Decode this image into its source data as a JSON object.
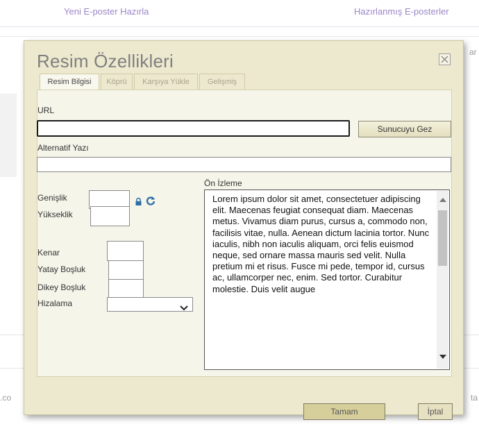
{
  "background": {
    "links": [
      "Yeni E-poster Hazırla",
      "Hazırlanmış E-posterler"
    ],
    "side_texts": [
      ".co",
      "ta",
      "ar"
    ]
  },
  "dialog": {
    "title": "Resim Özellikleri",
    "close_icon": "close-icon",
    "tabs": [
      {
        "label": "Resim Bilgisi",
        "active": true
      },
      {
        "label": "Köprü",
        "active": false
      },
      {
        "label": "Karşıya Yükle",
        "active": false
      },
      {
        "label": "Gelişmiş",
        "active": false
      }
    ],
    "url": {
      "label": "URL",
      "value": ""
    },
    "browse_button": "Sunucuyu Gez",
    "alt_text": {
      "label": "Alternatif Yazı",
      "value": ""
    },
    "width": {
      "label": "Genişlik",
      "value": ""
    },
    "height": {
      "label": "Yükseklik",
      "value": ""
    },
    "lock_icon": "lock-icon",
    "reset_icon": "reset-size-icon",
    "border": {
      "label": "Kenar",
      "value": ""
    },
    "hspace": {
      "label": "Yatay Boşluk",
      "value": ""
    },
    "vspace": {
      "label": "Dikey Boşluk",
      "value": ""
    },
    "align": {
      "label": "Hizalama",
      "selected": ""
    },
    "preview": {
      "label": "Ön İzleme",
      "text": "Lorem ipsum dolor sit amet, consectetuer adipiscing elit. Maecenas feugiat consequat diam. Maecenas metus. Vivamus diam purus, cursus a, commodo non, facilisis vitae, nulla. Aenean dictum lacinia tortor. Nunc iaculis, nibh non iaculis aliquam, orci felis euismod neque, sed ornare massa mauris sed velit. Nulla pretium mi et risus. Fusce mi pede, tempor id, cursus ac, ullamcorper nec, enim. Sed tortor. Curabitur molestie. Duis velit augue"
    },
    "ok_button": "Tamam",
    "cancel_button": "İptal"
  },
  "colors": {
    "dialog_bg": "#ede9cf",
    "panel_bg": "#f6f5ea",
    "link_purple": "#9b86c8",
    "icon_blue": "#2f6fa8"
  }
}
